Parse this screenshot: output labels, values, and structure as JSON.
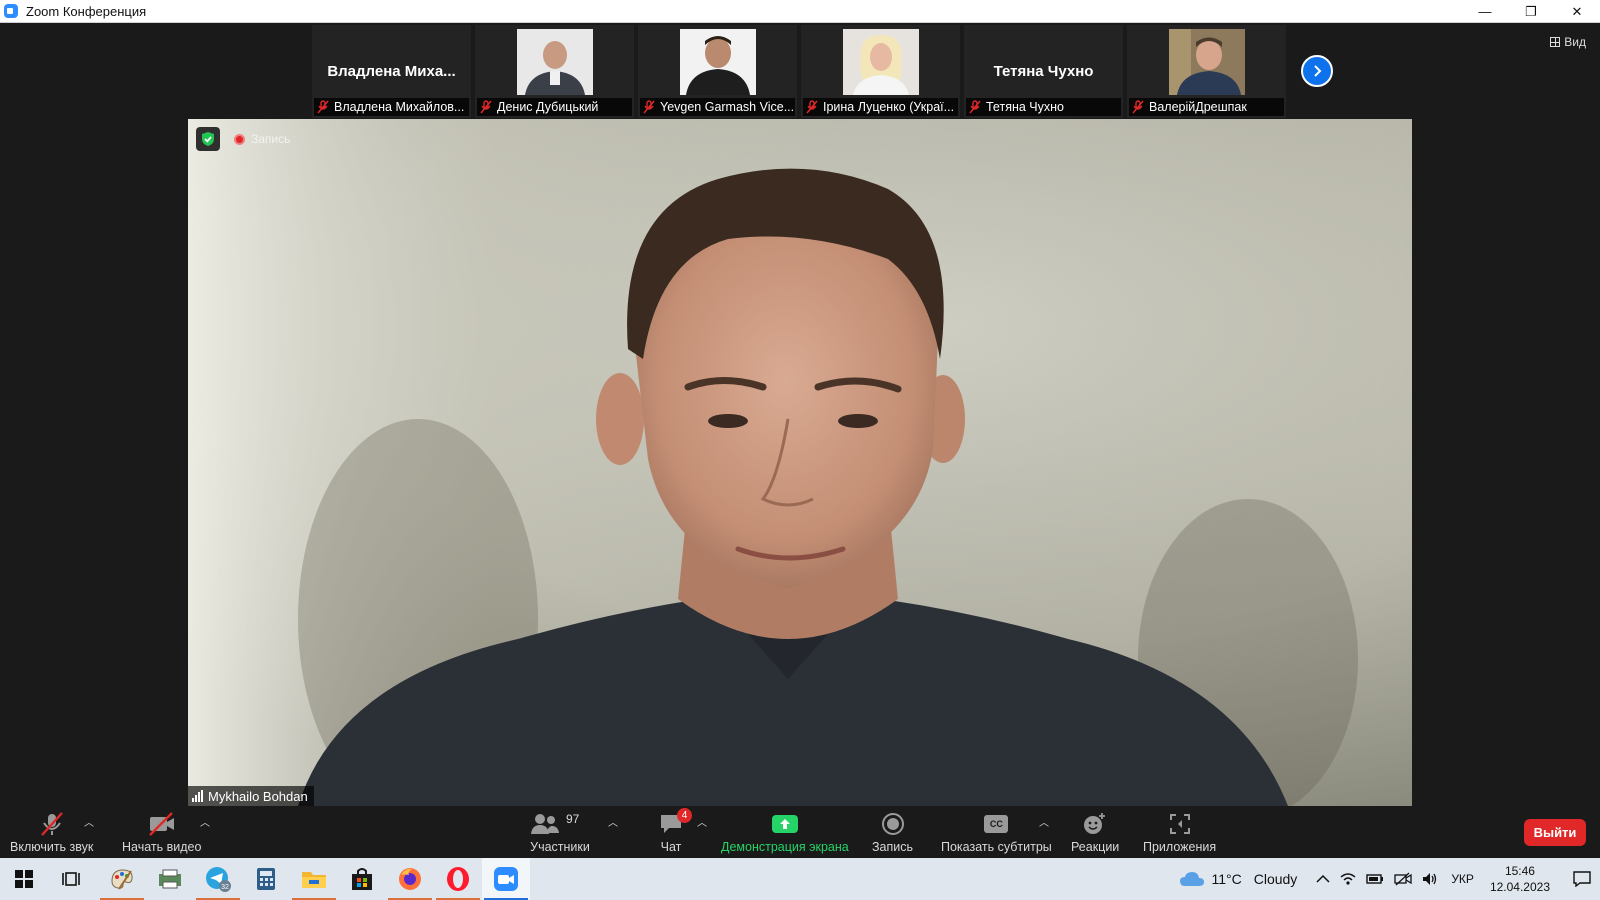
{
  "window": {
    "title": "Zoom Конференция",
    "minimize": "—",
    "restore": "❐",
    "close": "✕"
  },
  "view_button": {
    "label": "Вид"
  },
  "thumbnails": [
    {
      "display_name": "Владлена  Миха...",
      "label": "Владлена Михайлов...",
      "has_video": false
    },
    {
      "display_name": "",
      "label": "Денис Дубицький",
      "has_video": true
    },
    {
      "display_name": "",
      "label": "Yevgen Garmash Vice...",
      "has_video": true
    },
    {
      "display_name": "",
      "label": "Ірина Луценко (Украї...",
      "has_video": true
    },
    {
      "display_name": "Тетяна Чухно",
      "label": "Тетяна Чухно",
      "has_video": false
    },
    {
      "display_name": "",
      "label": "ВалерійДрешпак",
      "has_video": true
    }
  ],
  "main_video": {
    "speaker_name": "Mykhailo Bohdan",
    "recording_label": "Запись"
  },
  "toolbar": {
    "unmute_label": "Включить звук",
    "start_video_label": "Начать видео",
    "participants_label": "Участники",
    "participants_count": "97",
    "chat_label": "Чат",
    "chat_badge": "4",
    "share_label": "Демонстрация экрана",
    "record_label": "Запись",
    "captions_label": "Показать субтитры",
    "captions_icon_text": "CC",
    "reactions_label": "Реакции",
    "apps_label": "Приложения",
    "leave_label": "Выйти"
  },
  "taskbar": {
    "telegram_badge": "32",
    "weather_temp": "11°C",
    "weather_text": "Cloudy",
    "language": "УКР",
    "time": "15:46",
    "date": "12.04.2023"
  },
  "colors": {
    "accent_blue": "#0e72ed",
    "leave_red": "#e02828",
    "share_green": "#25d366"
  }
}
